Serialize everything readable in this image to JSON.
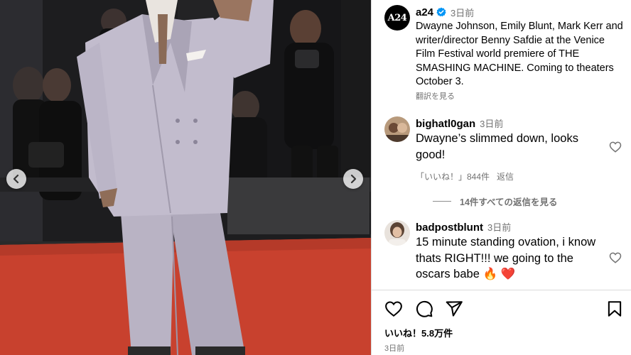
{
  "post": {
    "username": "a24",
    "time": "3日前",
    "avatar_text": "A24",
    "caption": "Dwayne Johnson, Emily Blunt, Mark Kerr and writer/director Benny Safdie at the Venice Film Festival world premiere of THE SMASHING MACHINE. Coming to theaters October 3.",
    "translate": "翻訳を見る"
  },
  "comments": [
    {
      "username": "bighatl0gan",
      "time": "3日前",
      "text": "Dwayne’s slimmed down, looks good!",
      "likes": "「いいね！」844件",
      "reply": "返信"
    },
    {
      "username": "badpostblunt",
      "time": "3日前",
      "text": "15 minute standing ovation, i know thats RIGHT!!! we going to the oscars babe 🔥 ❤️"
    }
  ],
  "replies_link": "14件すべての返信を見る",
  "footer": {
    "likes": "いいね！5.8万件",
    "date": "3日前"
  },
  "icons": {
    "verified": "verified-badge-icon",
    "like": "heart-icon",
    "comment": "comment-bubble-icon",
    "share": "paper-plane-icon",
    "save": "bookmark-icon",
    "prev": "chevron-left-icon",
    "next": "chevron-right-icon"
  },
  "colors": {
    "verified_blue": "#0095f6",
    "carpet_red": "#c8412e",
    "suit_lavender": "#b9b3c4",
    "secondary_text": "#737373"
  }
}
